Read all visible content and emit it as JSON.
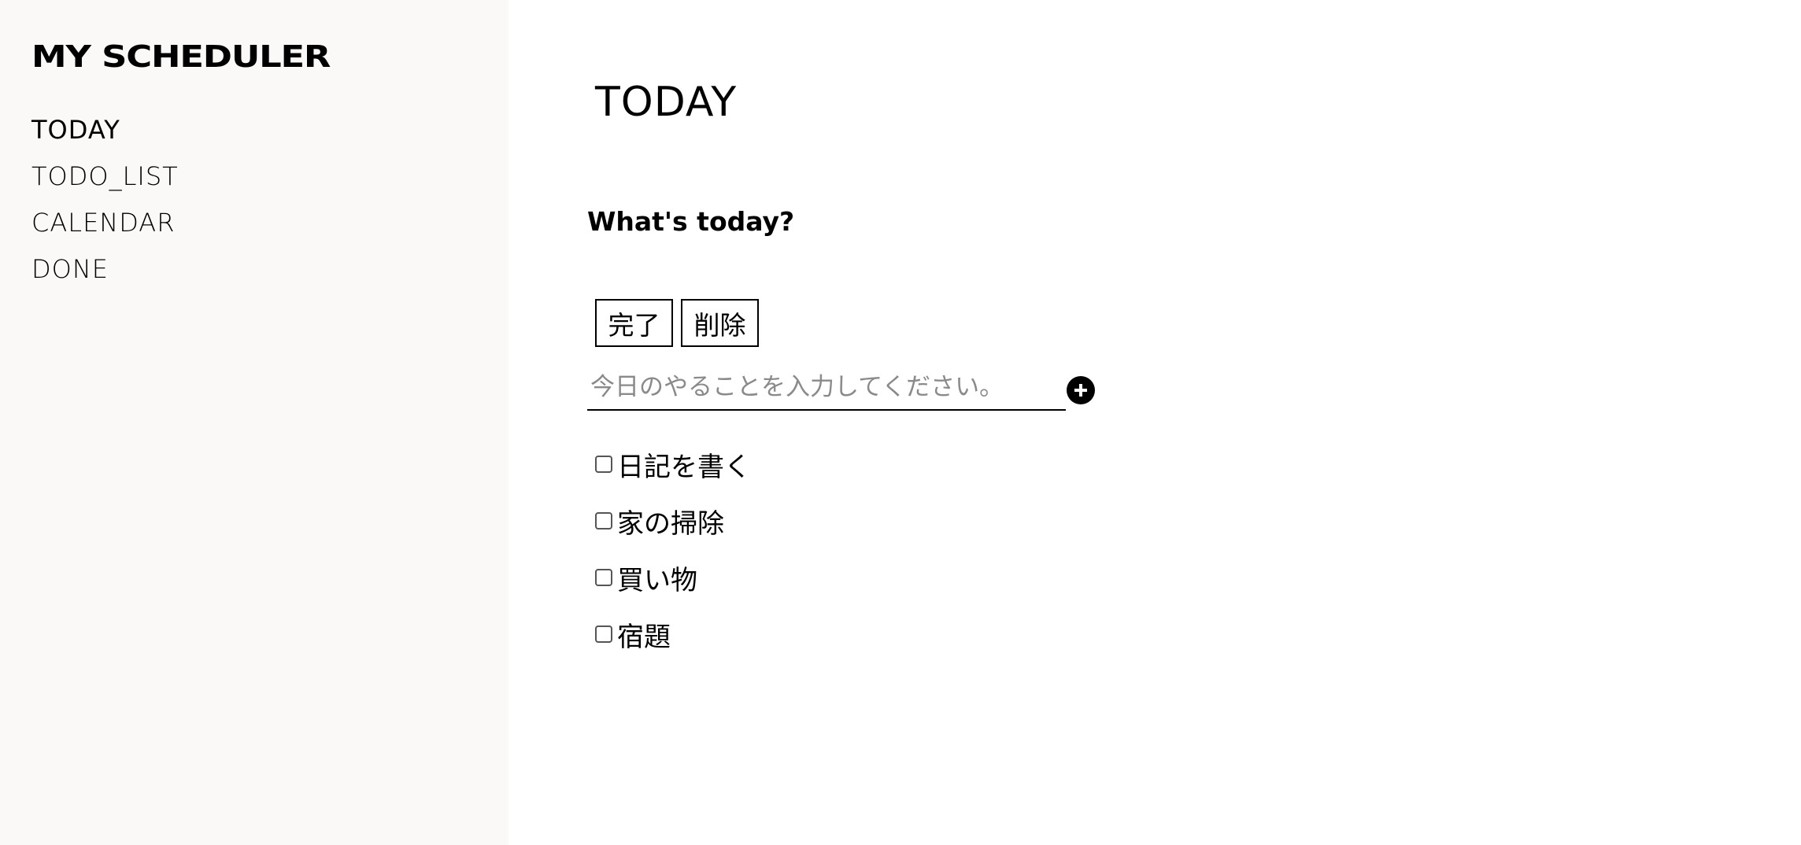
{
  "sidebar": {
    "logo": "MY SCHEDULER",
    "nav": [
      {
        "label": "TODAY",
        "active": true
      },
      {
        "label": "TODO_LIST",
        "active": false
      },
      {
        "label": "CALENDAR",
        "active": false
      },
      {
        "label": "DONE",
        "active": false
      }
    ]
  },
  "main": {
    "title": "TODAY",
    "subtitle": "What's today?",
    "buttons": {
      "complete_label": "完了",
      "delete_label": "削除"
    },
    "input": {
      "placeholder": "今日のやることを入力してください。",
      "value": ""
    },
    "add_icon": "plus-circle-icon",
    "todos": [
      {
        "label": "日記を書く",
        "checked": false
      },
      {
        "label": "家の掃除",
        "checked": false
      },
      {
        "label": "買い物",
        "checked": false
      },
      {
        "label": "宿題",
        "checked": false
      }
    ]
  }
}
